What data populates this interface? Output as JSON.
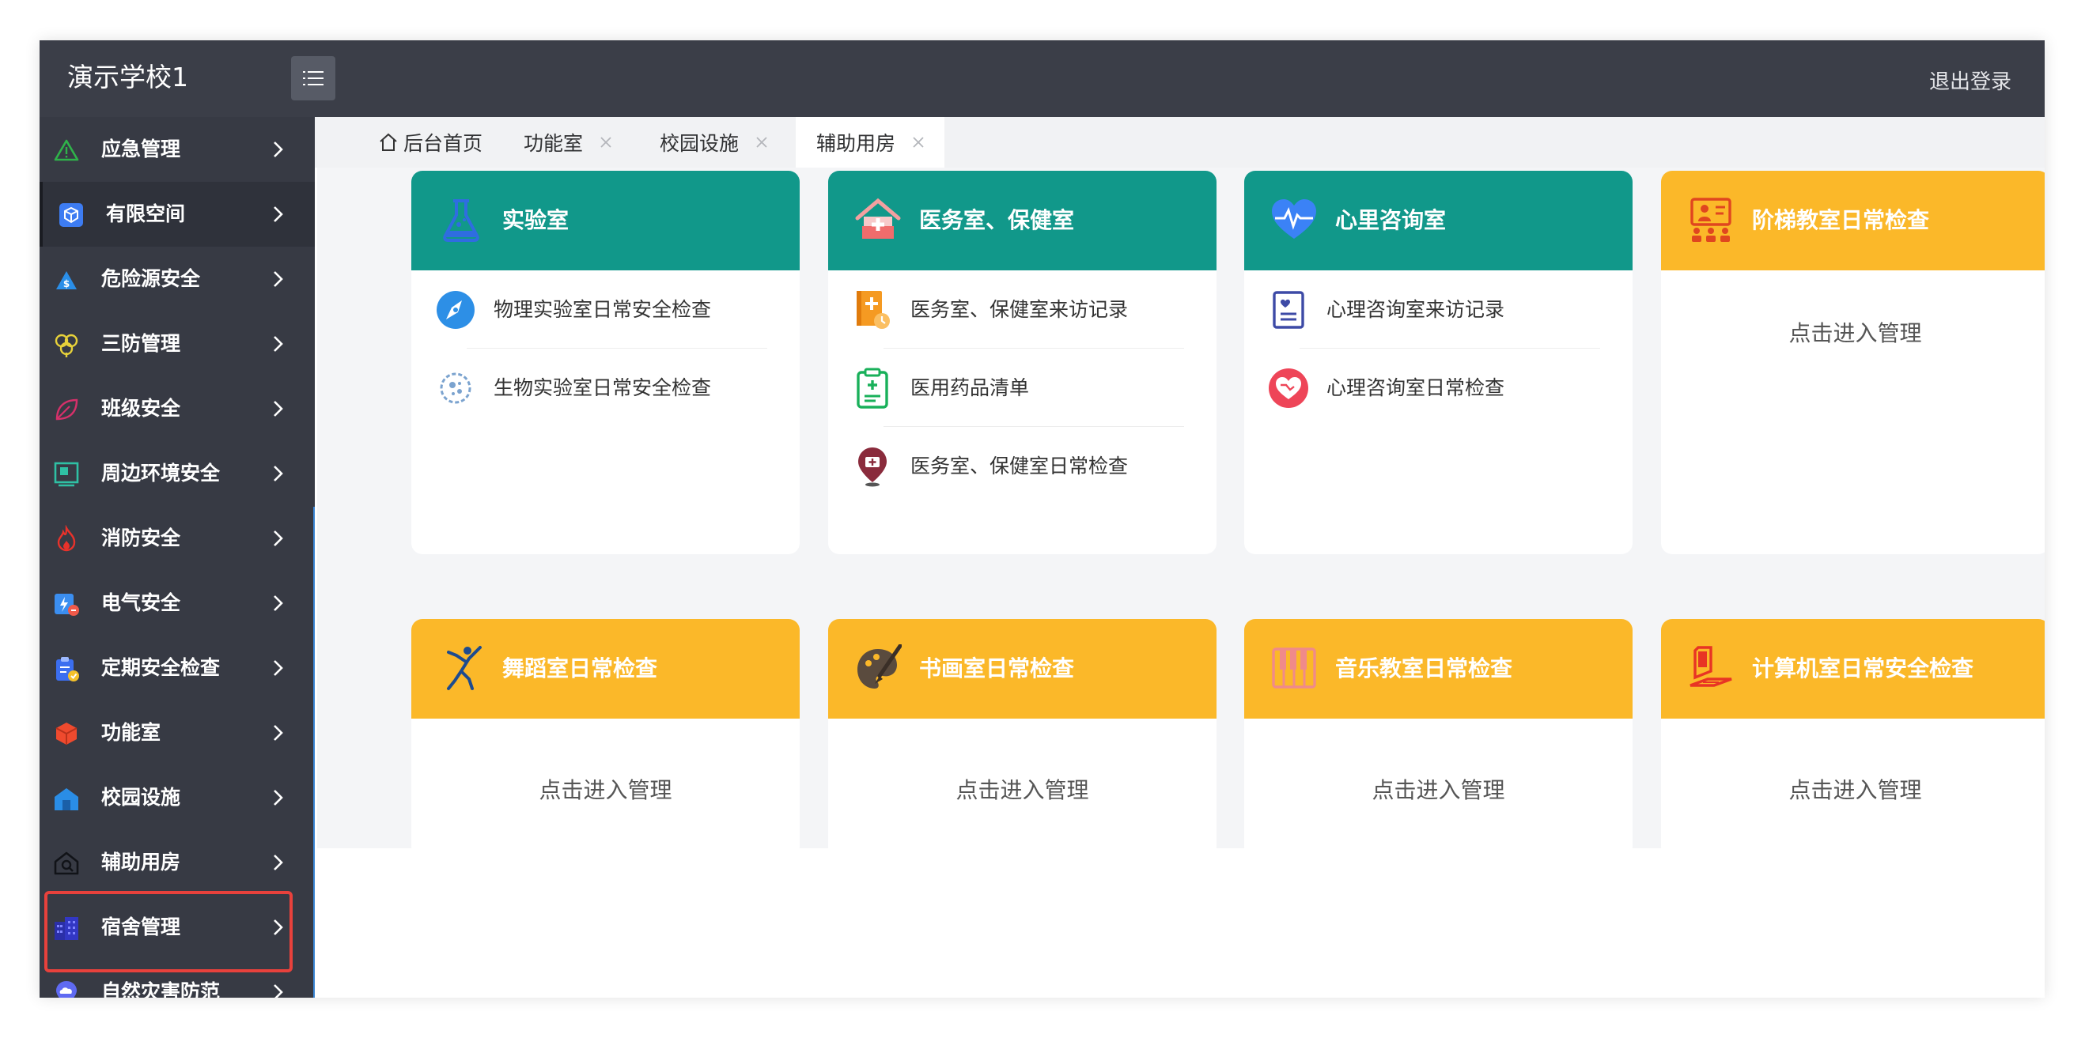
{
  "header": {
    "app_title": "演示学校1",
    "logout_label": "退出登录"
  },
  "sidebar": {
    "items": [
      {
        "label": "应急管理",
        "icon": "warning-triangle-icon"
      },
      {
        "label": "有限空间",
        "icon": "cube-icon"
      },
      {
        "label": "危险源安全",
        "icon": "hazard-icon"
      },
      {
        "label": "三防管理",
        "icon": "shield-flower-icon"
      },
      {
        "label": "班级安全",
        "icon": "leaf-icon"
      },
      {
        "label": "周边环境安全",
        "icon": "monitor-icon"
      },
      {
        "label": "消防安全",
        "icon": "flame-icon"
      },
      {
        "label": "电气安全",
        "icon": "electric-icon"
      },
      {
        "label": "定期安全检查",
        "icon": "clipboard-check-icon"
      },
      {
        "label": "功能室",
        "icon": "box-icon"
      },
      {
        "label": "校园设施",
        "icon": "building-icon"
      },
      {
        "label": "辅助用房",
        "icon": "house-search-icon"
      },
      {
        "label": "宿舍管理",
        "icon": "dormitory-icon"
      },
      {
        "label": "自然灾害防范",
        "icon": "cloud-pin-icon"
      }
    ]
  },
  "tabs": [
    {
      "label": "后台首页",
      "icon": "home-icon",
      "closable": false
    },
    {
      "label": "功能室",
      "closable": true
    },
    {
      "label": "校园设施",
      "closable": true
    },
    {
      "label": "辅助用房",
      "closable": true,
      "active": true
    }
  ],
  "colors": {
    "teal": "#11988a",
    "amber": "#fbb829",
    "header": "#3b3e48",
    "sidebar": "#373a44",
    "highlight": "#e8413c"
  },
  "cards": [
    {
      "title": "实验室",
      "icon": "flask-icon",
      "items": [
        {
          "label": "物理实验室日常安全检查",
          "icon": "compass-icon"
        },
        {
          "label": "生物实验室日常安全检查",
          "icon": "cell-icon"
        }
      ]
    },
    {
      "title": "医务室、保健室",
      "icon": "clinic-icon",
      "items": [
        {
          "label": "医务室、保健室来访记录",
          "icon": "medical-book-icon"
        },
        {
          "label": "医用药品清单",
          "icon": "medical-clipboard-icon"
        },
        {
          "label": "医务室、保健室日常检查",
          "icon": "medical-pin-icon"
        }
      ]
    },
    {
      "title": "心里咨询室",
      "icon": "heartbeat-icon",
      "items": [
        {
          "label": "心理咨询室来访记录",
          "icon": "record-sheet-icon"
        },
        {
          "label": "心理咨询室日常检查",
          "icon": "heart-handshake-icon"
        }
      ]
    },
    {
      "title": "阶梯教室日常检查",
      "icon": "lecture-hall-icon",
      "enter": "点击进入管理"
    },
    {
      "title": "舞蹈室日常检查",
      "icon": "dancer-icon",
      "enter": "点击进入管理"
    },
    {
      "title": "书画室日常检查",
      "icon": "palette-brush-icon",
      "enter": "点击进入管理"
    },
    {
      "title": "音乐教室日常检查",
      "icon": "piano-keys-icon",
      "enter": "点击进入管理"
    },
    {
      "title": "计算机室日常安全检查",
      "icon": "computer-icon",
      "enter": "点击进入管理"
    }
  ]
}
